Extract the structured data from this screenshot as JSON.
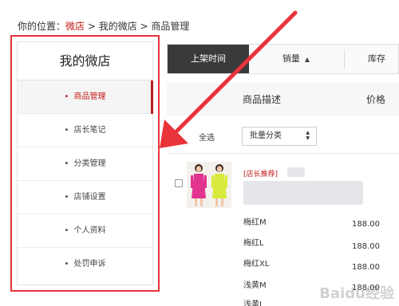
{
  "breadcrumb": {
    "prefix": "你的位置：",
    "link": "微店",
    "sep1": " > ",
    "mid": "我的微店",
    "sep2": " > ",
    "current": "商品管理"
  },
  "sidebar": {
    "title": "我的微店",
    "items": [
      {
        "label": "商品管理",
        "active": true
      },
      {
        "label": "店长笔记"
      },
      {
        "label": "分类管理"
      },
      {
        "label": "店铺设置"
      },
      {
        "label": "个人资料"
      },
      {
        "label": "处罚申诉"
      }
    ]
  },
  "tabs": [
    {
      "label": "上架时间",
      "active": true
    },
    {
      "label": "销量",
      "sort": "▲"
    },
    {
      "label": "库存"
    }
  ],
  "columns": {
    "desc": "商品描述",
    "price": "价格"
  },
  "select_all_label": "全选",
  "batch_select": {
    "value": "批量分类",
    "up": "▲",
    "down": "▼"
  },
  "product": {
    "tag": "[店长推荐]",
    "skus": [
      {
        "name": "梅红M",
        "price": "188.00"
      },
      {
        "name": "梅红L",
        "price": "188.00"
      },
      {
        "name": "梅红XL",
        "price": "188.00"
      },
      {
        "name": "浅黄M",
        "price": "188.00"
      },
      {
        "name": "浅黄L",
        "price": ""
      }
    ]
  },
  "colors": {
    "accent": "#c41a16",
    "highlight_border": "#e8333a",
    "tab_active": "#3a3a3a"
  },
  "watermark": "Baidu经验"
}
